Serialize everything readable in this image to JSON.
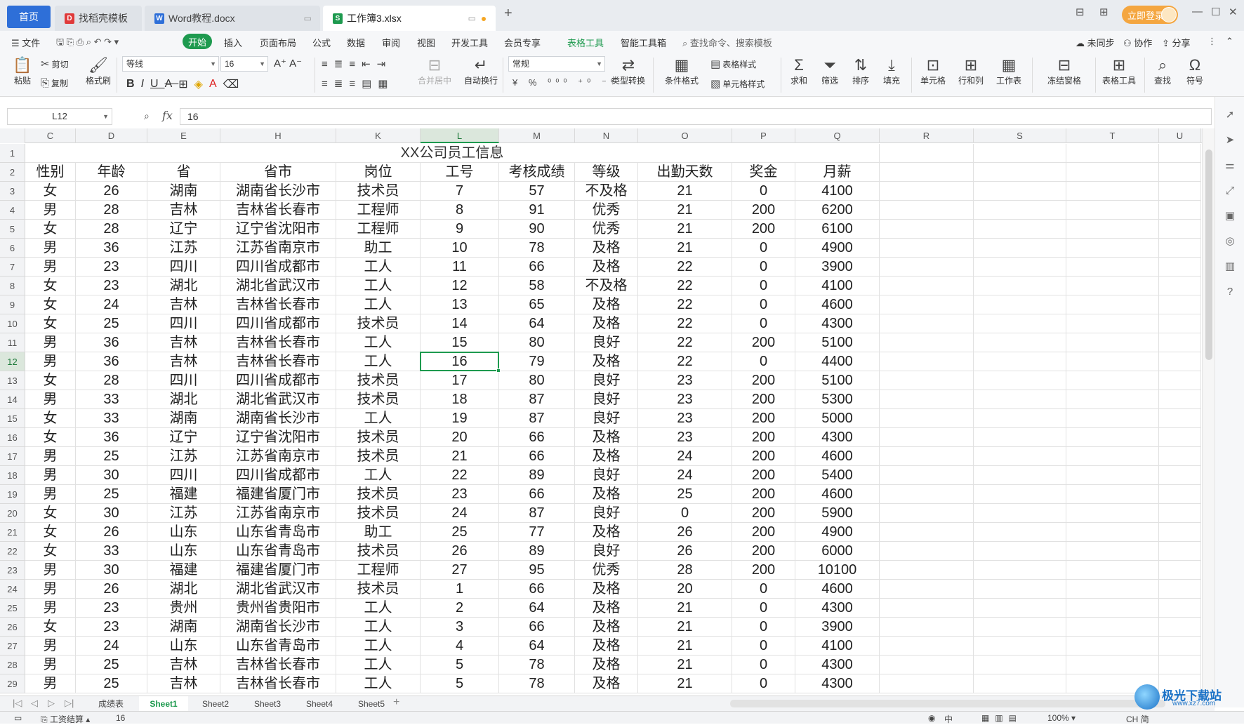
{
  "tabs": [
    {
      "label": "首页"
    },
    {
      "label": "找稻壳模板"
    },
    {
      "label": "Word教程.docx"
    },
    {
      "label": "工作簿3.xlsx"
    }
  ],
  "window": {
    "login_label": "立即登录"
  },
  "menu": {
    "file": "文件",
    "items": [
      "开始",
      "插入",
      "页面布局",
      "公式",
      "数据",
      "审阅",
      "视图",
      "开发工具",
      "会员专享",
      "表格工具",
      "智能工具箱"
    ],
    "search": "查找命令、搜索模板",
    "unsynced": "未同步",
    "collab": "协作",
    "share": "分享"
  },
  "toolbar": {
    "paste": "粘贴",
    "cut": "剪切",
    "copy": "复制",
    "format_painter": "格式刷",
    "font": "等线",
    "font_size": "16",
    "merge": "合并居中",
    "wrap": "自动换行",
    "number_format": "常规",
    "type_convert": "类型转换",
    "cond_format": "条件格式",
    "table_style": "表格样式",
    "cell_style": "单元格样式",
    "sum": "求和",
    "filter": "筛选",
    "sort": "排序",
    "fill": "填充",
    "cell": "单元格",
    "rowcol": "行和列",
    "worksheet": "工作表",
    "freeze": "冻结窗格",
    "table_tools": "表格工具",
    "find": "查找",
    "symbol": "符号"
  },
  "formula": {
    "cell_ref": "L12",
    "value": "16"
  },
  "sheet": {
    "columns": [
      {
        "name": "C"
      },
      {
        "name": "D"
      },
      {
        "name": "E"
      },
      {
        "name": "H"
      },
      {
        "name": "K"
      },
      {
        "name": "L"
      },
      {
        "name": "M"
      },
      {
        "name": "N"
      },
      {
        "name": "O"
      },
      {
        "name": "P"
      },
      {
        "name": "Q"
      },
      {
        "name": "R"
      },
      {
        "name": "S"
      },
      {
        "name": "T"
      },
      {
        "name": "U"
      }
    ],
    "selected_column": "L",
    "selected_row": 12,
    "title": "XX公司员工信息",
    "headers": [
      "性别",
      "年龄",
      "省",
      "省市",
      "岗位",
      "工号",
      "考核成绩",
      "等级",
      "出勤天数",
      "奖金",
      "月薪"
    ],
    "rows": [
      [
        "女",
        "26",
        "湖南",
        "湖南省长沙市",
        "技术员",
        "7",
        "57",
        "不及格",
        "21",
        "0",
        "4100"
      ],
      [
        "男",
        "28",
        "吉林",
        "吉林省长春市",
        "工程师",
        "8",
        "91",
        "优秀",
        "21",
        "200",
        "6200"
      ],
      [
        "女",
        "28",
        "辽宁",
        "辽宁省沈阳市",
        "工程师",
        "9",
        "90",
        "优秀",
        "21",
        "200",
        "6100"
      ],
      [
        "男",
        "36",
        "江苏",
        "江苏省南京市",
        "助工",
        "10",
        "78",
        "及格",
        "21",
        "0",
        "4900"
      ],
      [
        "男",
        "23",
        "四川",
        "四川省成都市",
        "工人",
        "11",
        "66",
        "及格",
        "22",
        "0",
        "3900"
      ],
      [
        "女",
        "23",
        "湖北",
        "湖北省武汉市",
        "工人",
        "12",
        "58",
        "不及格",
        "22",
        "0",
        "4100"
      ],
      [
        "女",
        "24",
        "吉林",
        "吉林省长春市",
        "工人",
        "13",
        "65",
        "及格",
        "22",
        "0",
        "4600"
      ],
      [
        "女",
        "25",
        "四川",
        "四川省成都市",
        "技术员",
        "14",
        "64",
        "及格",
        "22",
        "0",
        "4300"
      ],
      [
        "男",
        "36",
        "吉林",
        "吉林省长春市",
        "工人",
        "15",
        "80",
        "良好",
        "22",
        "200",
        "5100"
      ],
      [
        "男",
        "36",
        "吉林",
        "吉林省长春市",
        "工人",
        "16",
        "79",
        "及格",
        "22",
        "0",
        "4400"
      ],
      [
        "女",
        "28",
        "四川",
        "四川省成都市",
        "技术员",
        "17",
        "80",
        "良好",
        "23",
        "200",
        "5100"
      ],
      [
        "男",
        "33",
        "湖北",
        "湖北省武汉市",
        "技术员",
        "18",
        "87",
        "良好",
        "23",
        "200",
        "5300"
      ],
      [
        "女",
        "33",
        "湖南",
        "湖南省长沙市",
        "工人",
        "19",
        "87",
        "良好",
        "23",
        "200",
        "5000"
      ],
      [
        "女",
        "36",
        "辽宁",
        "辽宁省沈阳市",
        "技术员",
        "20",
        "66",
        "及格",
        "23",
        "200",
        "4300"
      ],
      [
        "男",
        "25",
        "江苏",
        "江苏省南京市",
        "技术员",
        "21",
        "66",
        "及格",
        "24",
        "200",
        "4600"
      ],
      [
        "男",
        "30",
        "四川",
        "四川省成都市",
        "工人",
        "22",
        "89",
        "良好",
        "24",
        "200",
        "5400"
      ],
      [
        "男",
        "25",
        "福建",
        "福建省厦门市",
        "技术员",
        "23",
        "66",
        "及格",
        "25",
        "200",
        "4600"
      ],
      [
        "女",
        "30",
        "江苏",
        "江苏省南京市",
        "技术员",
        "24",
        "87",
        "良好",
        "0",
        "200",
        "5900"
      ],
      [
        "女",
        "26",
        "山东",
        "山东省青岛市",
        "助工",
        "25",
        "77",
        "及格",
        "26",
        "200",
        "4900"
      ],
      [
        "女",
        "33",
        "山东",
        "山东省青岛市",
        "技术员",
        "26",
        "89",
        "良好",
        "26",
        "200",
        "6000"
      ],
      [
        "男",
        "30",
        "福建",
        "福建省厦门市",
        "工程师",
        "27",
        "95",
        "优秀",
        "28",
        "200",
        "10100"
      ],
      [
        "男",
        "26",
        "湖北",
        "湖北省武汉市",
        "技术员",
        "1",
        "66",
        "及格",
        "20",
        "0",
        "4600"
      ],
      [
        "男",
        "23",
        "贵州",
        "贵州省贵阳市",
        "工人",
        "2",
        "64",
        "及格",
        "21",
        "0",
        "4300"
      ],
      [
        "女",
        "23",
        "湖南",
        "湖南省长沙市",
        "工人",
        "3",
        "66",
        "及格",
        "21",
        "0",
        "3900"
      ],
      [
        "男",
        "24",
        "山东",
        "山东省青岛市",
        "工人",
        "4",
        "64",
        "及格",
        "21",
        "0",
        "4100"
      ],
      [
        "男",
        "25",
        "吉林",
        "吉林省长春市",
        "工人",
        "5",
        "78",
        "及格",
        "21",
        "0",
        "4300"
      ],
      [
        "男",
        "25",
        "吉林",
        "吉林省长春市",
        "工人",
        "5",
        "78",
        "及格",
        "21",
        "0",
        "4300"
      ]
    ]
  },
  "sheet_tabs": [
    "成绩表",
    "Sheet1",
    "Sheet2",
    "Sheet3",
    "Sheet4",
    "Sheet5"
  ],
  "active_sheet": "Sheet1",
  "status": {
    "macro": "工资结算",
    "value": "16",
    "zoom": "100%",
    "ime": "CH",
    "ime_mode": "简",
    "ime_lang": "中"
  },
  "watermark": {
    "text": "极光下载站",
    "url": "www.xz7.com"
  }
}
